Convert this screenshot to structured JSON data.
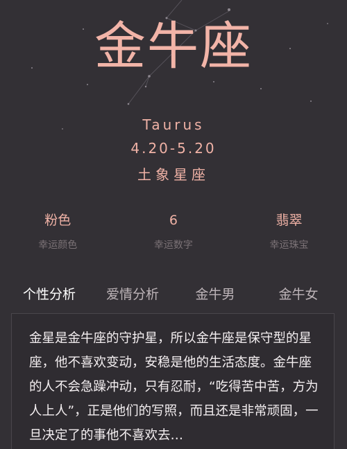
{
  "header": {
    "title": "金牛座",
    "english_name": "Taurus",
    "date_range": "4.20-5.20",
    "element": "土象星座"
  },
  "lucky": [
    {
      "value": "粉色",
      "label": "幸运颜色"
    },
    {
      "value": "6",
      "label": "幸运数字"
    },
    {
      "value": "翡翠",
      "label": "幸运珠宝"
    }
  ],
  "tabs": [
    {
      "label": "个性分析",
      "active": true
    },
    {
      "label": "爱情分析",
      "active": false
    },
    {
      "label": "金牛男",
      "active": false
    },
    {
      "label": "金牛女",
      "active": false
    }
  ],
  "content": {
    "text": "金星是金牛座的守护星，所以金牛座是保守型的星座，他不喜欢变动，安稳是他的生活态度。金牛座的人不会急躁冲动，只有忍耐，“吃得苦中苦，方为人上人”，正是他们的写照，而且还是非常顽固，一旦决定了的事他不喜欢去…"
  },
  "colors": {
    "background": "#333035",
    "accent": "#f0b2a6",
    "muted_label": "#7b7276"
  }
}
